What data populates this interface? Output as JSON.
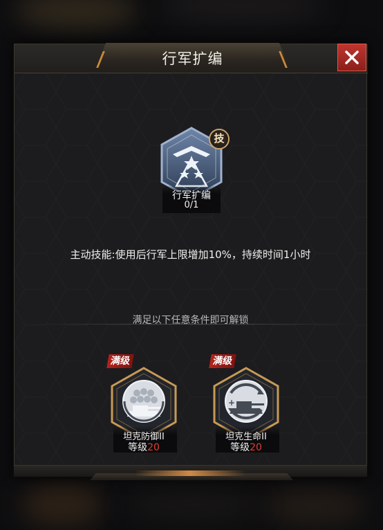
{
  "dialog": {
    "title": "行军扩编",
    "close_icon": "close-icon"
  },
  "skill": {
    "tag": "技",
    "name": "行军扩编",
    "count": "0/1",
    "icon": "triple-star-chevron-icon",
    "description": "主动技能:使用后行军上限增加10%，持续时间1小时"
  },
  "unlock": {
    "hint": "满足以下任意条件即可解锁",
    "requirements": [
      {
        "badge": "满级",
        "name": "坦克防御II",
        "level_prefix": "等级",
        "level": "20",
        "icon": "tank-shield-icon"
      },
      {
        "badge": "满级",
        "name": "坦克生命II",
        "level_prefix": "等级",
        "level": "20",
        "icon": "tank-health-icon"
      }
    ]
  },
  "colors": {
    "accent_gold": "#c9a46a",
    "close_red": "#b52a24",
    "level_red": "#e1402f",
    "panel_bg": "#1c1c1e"
  }
}
